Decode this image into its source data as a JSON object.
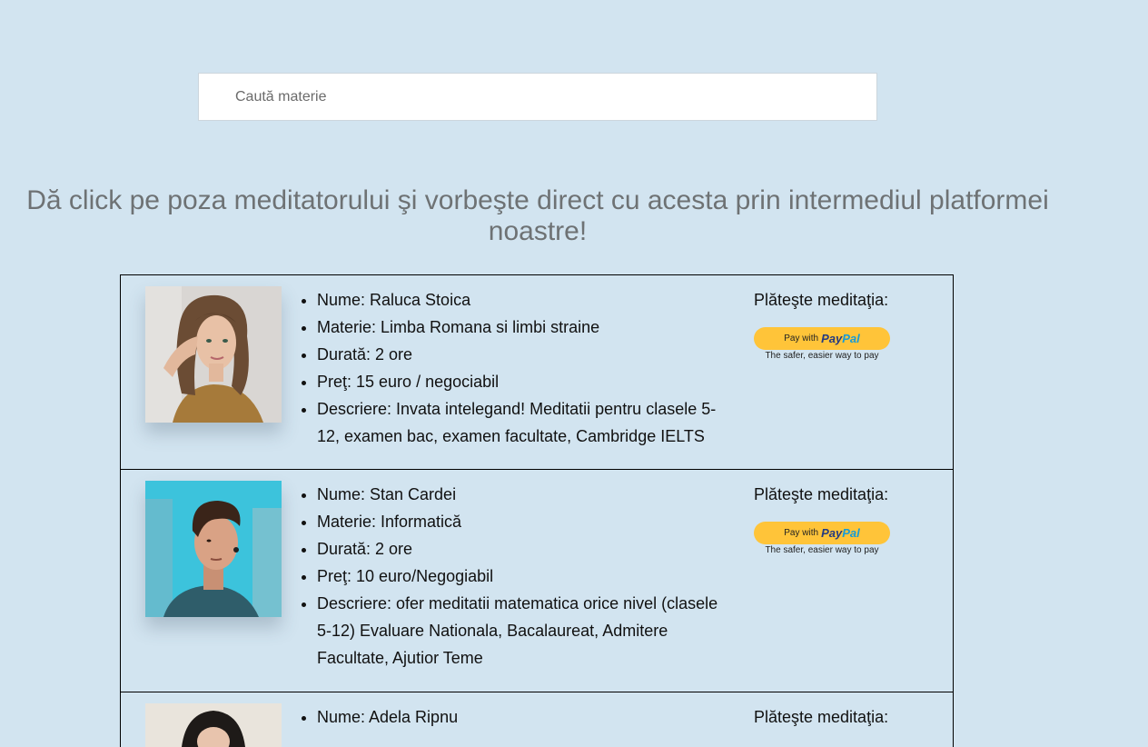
{
  "search": {
    "placeholder": "Caută materie"
  },
  "headline": "Dă click pe poza meditatorului şi vorbeşte direct cu acesta prin intermediul platformei noastre!",
  "payment": {
    "label": "Plăteşte meditaţia:",
    "button_prefix": "Pay with",
    "logo_part1": "Pay",
    "logo_part2": "Pal",
    "tagline": "The safer, easier way to pay"
  },
  "tutors": [
    {
      "name": "Nume: Raluca Stoica",
      "subject": "Materie: Limba Romana si limbi straine",
      "duration": "Durată: 2 ore",
      "price": "Preţ: 15 euro / negociabil",
      "description": "Descriere: Invata intelegand! Meditatii pentru clasele 5-12, examen bac, examen facultate, Cambridge IELTS",
      "photo": "woman-portrait"
    },
    {
      "name": "Nume: Stan Cardei",
      "subject": "Materie: Informatică",
      "duration": "Durată: 2 ore",
      "price": "Preţ: 10 euro/Negogiabil",
      "description": "Descriere: ofer meditatii matematica orice nivel (clasele 5-12) Evaluare Nationala, Bacalaureat, Admitere Facultate, Ajutior Teme",
      "photo": "man-portrait"
    },
    {
      "name": "Nume: Adela Ripnu",
      "photo": "woman-portrait"
    }
  ],
  "colors": {
    "background": "#d2e4f0",
    "paypal_button": "#ffc439"
  }
}
